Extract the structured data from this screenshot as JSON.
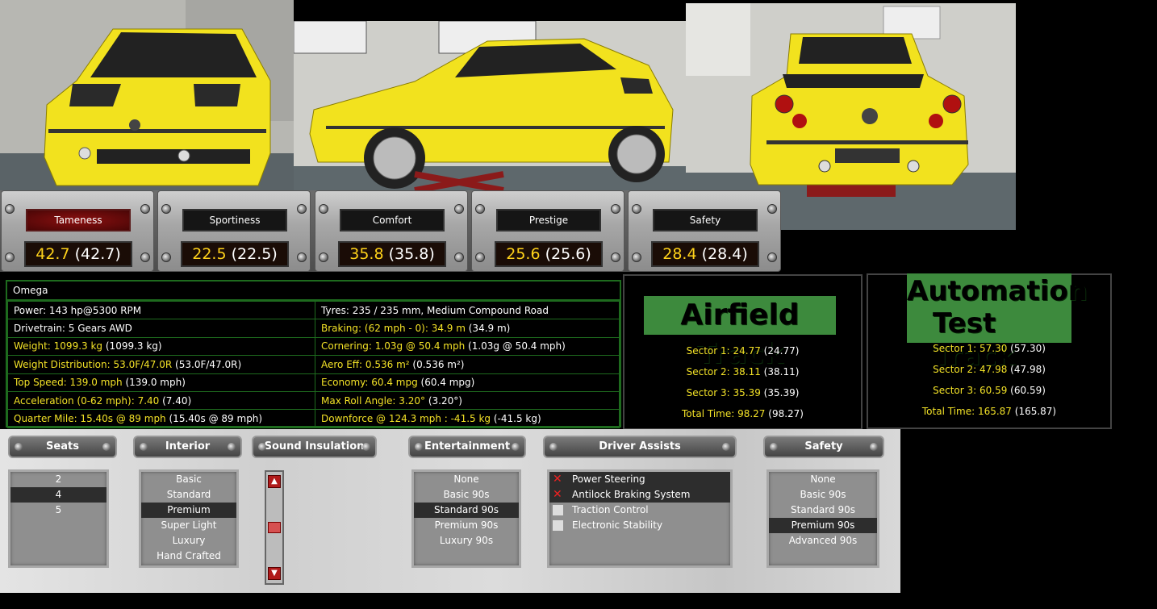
{
  "attributes": [
    {
      "label": "Tameness",
      "value": "42.7",
      "base": "(42.7)",
      "active": true
    },
    {
      "label": "Sportiness",
      "value": "22.5",
      "base": "(22.5)",
      "active": false
    },
    {
      "label": "Comfort",
      "value": "35.8",
      "base": "(35.8)",
      "active": false
    },
    {
      "label": "Prestige",
      "value": "25.6",
      "base": "(25.6)",
      "active": false
    },
    {
      "label": "Safety",
      "value": "28.4",
      "base": "(28.4)",
      "active": false
    }
  ],
  "stats": {
    "name": "Omega",
    "rows": [
      [
        {
          "t": "Power: 143 hp@5300 RPM",
          "p": "",
          "y": false
        },
        {
          "t": "Tyres: 235 / 235 mm, Medium Compound Road",
          "p": "",
          "y": false
        }
      ],
      [
        {
          "t": "Drivetrain: 5 Gears AWD",
          "p": "",
          "y": false
        },
        {
          "t": "Braking: (62 mph - 0): 34.9 m",
          "p": "(34.9 m)",
          "y": true
        }
      ],
      [
        {
          "t": "Weight: 1099.3 kg",
          "p": "(1099.3 kg)",
          "y": true
        },
        {
          "t": "Cornering: 1.03g @ 50.4 mph",
          "p": "(1.03g @ 50.4 mph)",
          "y": true
        }
      ],
      [
        {
          "t": "Weight Distribution: 53.0F/47.0R",
          "p": "(53.0F/47.0R)",
          "y": true
        },
        {
          "t": "Aero Eff: 0.536 m²",
          "p": "(0.536 m²)",
          "y": true
        }
      ],
      [
        {
          "t": "Top Speed: 139.0 mph",
          "p": "(139.0 mph)",
          "y": true
        },
        {
          "t": "Economy: 60.4 mpg",
          "p": "(60.4 mpg)",
          "y": true
        }
      ],
      [
        {
          "t": "Acceleration (0-62 mph): 7.40",
          "p": "(7.40)",
          "y": true
        },
        {
          "t": "Max Roll Angle: 3.20°",
          "p": "(3.20°)",
          "y": true
        }
      ],
      [
        {
          "t": "Quarter Mile: 15.40s @ 89 mph",
          "p": "(15.40s @ 89 mph)",
          "y": true
        },
        {
          "t": "Downforce @ 124.3 mph : -41.5 kg",
          "p": "(-41.5 kg)",
          "y": true
        }
      ]
    ]
  },
  "tracks": {
    "airfield": {
      "title": "Airfield Track",
      "rows": [
        {
          "t": "Sector 1: 24.77",
          "p": "(24.77)"
        },
        {
          "t": "Sector 2: 38.11",
          "p": "(38.11)"
        },
        {
          "t": "Sector 3: 35.39",
          "p": "(35.39)"
        },
        {
          "t": "Total Time: 98.27",
          "p": "(98.27)"
        }
      ]
    },
    "automation": {
      "title_line1": "Automation",
      "title_line2": "Test Track",
      "rows": [
        {
          "t": "Sector 1: 57.30",
          "p": "(57.30)"
        },
        {
          "t": "Sector 2: 47.98",
          "p": "(47.98)"
        },
        {
          "t": "Sector 3: 60.59",
          "p": "(60.59)"
        },
        {
          "t": "Total Time: 165.87",
          "p": "(165.87)"
        }
      ]
    }
  },
  "options": {
    "seats": {
      "title": "Seats",
      "items": [
        "2",
        "4",
        "5"
      ],
      "selected": 1
    },
    "interior": {
      "title": "Interior",
      "items": [
        "Basic",
        "Standard",
        "Premium",
        "Super Light",
        "Luxury",
        "Hand Crafted"
      ],
      "selected": 2
    },
    "sound": {
      "title": "Sound Insulation"
    },
    "entertainment": {
      "title": "Entertainment",
      "items": [
        "None",
        "Basic 90s",
        "Standard 90s",
        "Premium 90s",
        "Luxury 90s"
      ],
      "selected": 2
    },
    "driver_assists": {
      "title": "Driver Assists",
      "items": [
        {
          "label": "Power Steering",
          "on": true
        },
        {
          "label": "Antilock Braking System",
          "on": true
        },
        {
          "label": "Traction Control",
          "on": false
        },
        {
          "label": "Electronic Stability",
          "on": false
        }
      ]
    },
    "safety": {
      "title": "Safety",
      "items": [
        "None",
        "Basic 90s",
        "Standard 90s",
        "Premium 90s",
        "Advanced 90s"
      ],
      "selected": 3
    }
  },
  "colors": {
    "accent_yellow": "#f3e227",
    "panel_green": "#3d8a3d",
    "car_yellow": "#f2e21e"
  }
}
